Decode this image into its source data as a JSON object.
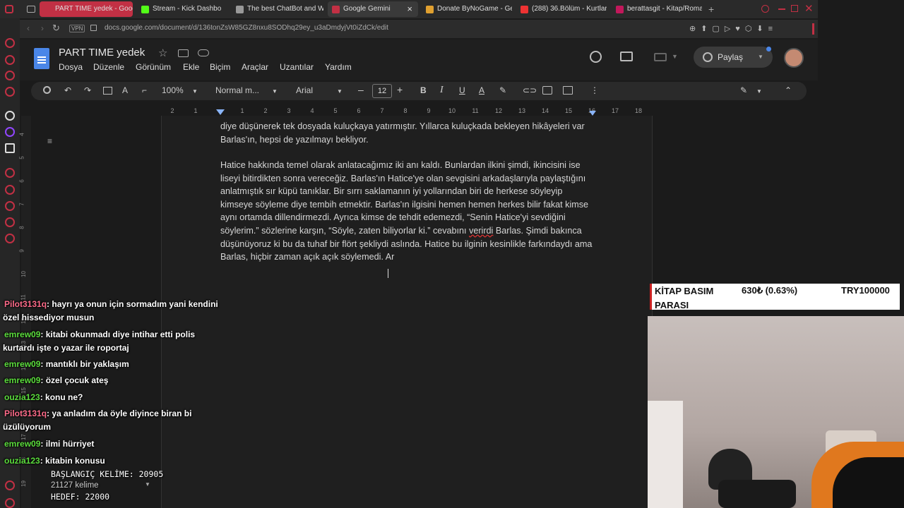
{
  "browser": {
    "tabs": [
      {
        "label": "PART TIME yedek - Goog",
        "active": true,
        "color": "#c23044"
      },
      {
        "label": "Stream - Kick Dashbo",
        "color": "#53fc18"
      },
      {
        "label": "The best ChatBot and Wr",
        "color": "#999999"
      },
      {
        "label": "Google Gemini",
        "color": "#c23044",
        "close": "×"
      },
      {
        "label": "Donate ByNoGame - Gek",
        "color": "#e0a030"
      },
      {
        "label": "(288) 36.Bölüm - Kurtlar",
        "color": "#e33"
      },
      {
        "label": "berattasgit - Kitap/Roman",
        "color": "#c2185b"
      }
    ],
    "url": "docs.google.com/document/d/136tonZsW85GZ8nxu8SODhq29ey_u3aDmdyjVt0iZdCk/edit",
    "vpn": "VPN"
  },
  "docs": {
    "title": "PART TIME  yedek",
    "menu": [
      "Dosya",
      "Düzenle",
      "Görünüm",
      "Ekle",
      "Biçim",
      "Araçlar",
      "Uzantılar",
      "Yardım"
    ],
    "share": "Paylaş",
    "toolbar": {
      "zoom": "100%",
      "style": "Normal m...",
      "font": "Arial",
      "size": "12"
    },
    "ruler": [
      "2",
      "1",
      "1",
      "2",
      "3",
      "4",
      "5",
      "6",
      "7",
      "8",
      "9",
      "10",
      "11",
      "12",
      "13",
      "14",
      "15",
      "16",
      "17",
      "18"
    ],
    "vruler": [
      "4",
      "5",
      "6",
      "7",
      "8",
      "9",
      "10",
      "11",
      "12",
      "13",
      "14",
      "15",
      "16",
      "17",
      "18",
      "19"
    ],
    "para1": "diye düşünerek tek dosyada kuluçkaya yatırmıştır. Yıllarca kuluçkada bekleyen hikâyeleri var Barlas'ın, hepsi de yazılmayı bekliyor.",
    "para2_a": "Hatice hakkında temel olarak anlatacağımız iki anı kaldı. Bunlardan ilkini şimdi, ikincisini ise liseyi bitirdikten sonra vereceğiz. Barlas'ın Hatice'ye olan sevgisini arkadaşlarıyla paylaştığını anlatmıştık sır küpü tanıklar. Bir sırrı saklamanın iyi yollarından biri de herkese söyleyip kimseye söyleme diye tembih etmektir. Barlas'ın ilgisini hemen hemen herkes bilir fakat kimse aynı ortamda dillendirmezdi. Ayrıca kimse de tehdit edemezdi, “Senin Hatice'yi sevdiğini söylerim.” sözlerine karşın, “Söyle, zaten biliyorlar ki.” cevabını ",
    "para2_spell": "verirdi",
    "para2_b": " Barlas. Şimdi bakınca düşünüyoruz ki bu da tuhaf bir flört şekliydi aslında. Hatice bu ilginin kesinlikle farkındaydı ama Barlas, hiçbir zaman açık açık söylemedi. Ar"
  },
  "chat": [
    {
      "user": "Pilot3131q",
      "color": "#ff6b8a",
      "msg": ": hayrı ya onun için sormadım yani kendini özel hissediyor musun"
    },
    {
      "user": "emrew09",
      "color": "#5bdd3c",
      "msg": ": kitabi okunmadı diye intihar etti polis kurtardı işte o yazar ile roportaj"
    },
    {
      "user": "emrew09",
      "color": "#5bdd3c",
      "msg": ": mantıklı bir yaklaşım"
    },
    {
      "user": "emrew09",
      "color": "#5bdd3c",
      "msg": ": özel çocuk ateş"
    },
    {
      "user": "ouzia123",
      "color": "#5bdd3c",
      "msg": ": konu ne?"
    },
    {
      "user": "Pilot3131q",
      "color": "#ff6b8a",
      "msg": ": ya anladım da öyle diyince biran bi üzülüyorum"
    },
    {
      "user": "emrew09",
      "color": "#5bdd3c",
      "msg": ": ilmi hürriyet"
    },
    {
      "user": "ouzia123",
      "color": "#5bdd3c",
      "msg": ": kitabin konusu"
    }
  ],
  "overlay": {
    "kitap_label": "KİTAP BASIM PARASI",
    "kitap_amount": "630₺ (0.63%)",
    "kitap_goal": "TRY100000",
    "start_words": "BAŞLANGIÇ KELİME: 20905",
    "word_count": "21127 kelime",
    "target": "HEDEF: 22000"
  }
}
